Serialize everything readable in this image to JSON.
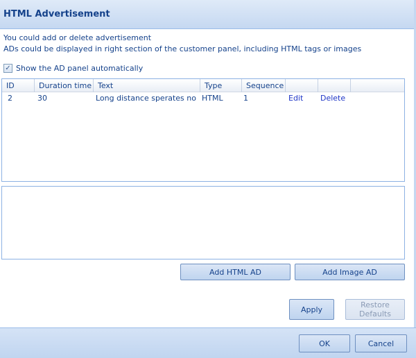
{
  "header": {
    "title": "HTML Advertisement"
  },
  "description": {
    "line1": "You could add or delete advertisement",
    "line2": "ADs could be displayed in right section of the customer panel, including HTML tags or images"
  },
  "show_panel": {
    "label": "Show the AD panel automatically",
    "checked": true,
    "check_glyph": "✓"
  },
  "grid": {
    "columns": [
      "ID",
      "Duration time",
      "Text",
      "Type",
      "Sequence",
      "",
      ""
    ],
    "rows": [
      {
        "id": "2",
        "duration": "30",
        "text": "Long distance sperates no",
        "type": "HTML",
        "sequence": "1",
        "edit": "Edit",
        "delete": "Delete"
      }
    ]
  },
  "buttons": {
    "add_html": "Add HTML AD",
    "add_image": "Add Image AD",
    "apply": "Apply",
    "restore": "Restore Defaults",
    "ok": "OK",
    "cancel": "Cancel"
  },
  "colors": {
    "accent": "#15428b",
    "link": "#1f36c7",
    "border": "#8db2e3"
  }
}
